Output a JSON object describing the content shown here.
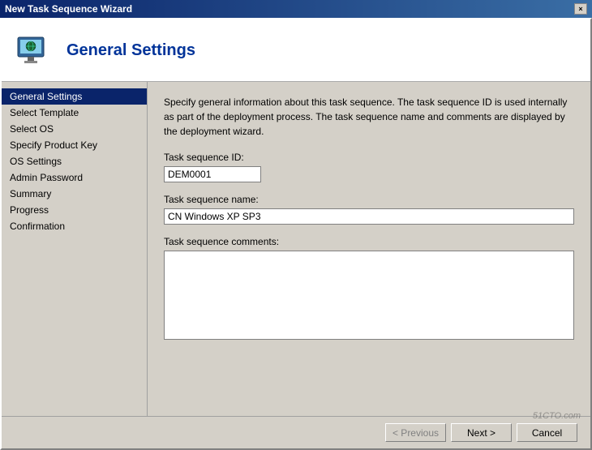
{
  "titleBar": {
    "title": "New Task Sequence Wizard",
    "closeBtn": "×"
  },
  "header": {
    "title": "General Settings"
  },
  "sidebar": {
    "items": [
      {
        "label": "General Settings",
        "active": true
      },
      {
        "label": "Select Template",
        "active": false
      },
      {
        "label": "Select OS",
        "active": false
      },
      {
        "label": "Specify Product Key",
        "active": false
      },
      {
        "label": "OS Settings",
        "active": false
      },
      {
        "label": "Admin Password",
        "active": false
      },
      {
        "label": "Summary",
        "active": false
      },
      {
        "label": "Progress",
        "active": false
      },
      {
        "label": "Confirmation",
        "active": false
      }
    ]
  },
  "content": {
    "description": "Specify general information about this task sequence.  The task sequence ID is used internally as part of the deployment process.  The task sequence name and comments are displayed by the deployment wizard.",
    "taskIdLabel": "Task sequence ID:",
    "taskIdValue": "DEM0001",
    "taskNameLabel": "Task sequence name:",
    "taskNameValue": "CN Windows XP SP3",
    "taskCommentsLabel": "Task sequence comments:",
    "taskCommentsValue": ""
  },
  "footer": {
    "previousBtn": "< Previous",
    "nextBtn": "Next >",
    "cancelBtn": "Cancel"
  },
  "watermark": "51CTO.com"
}
